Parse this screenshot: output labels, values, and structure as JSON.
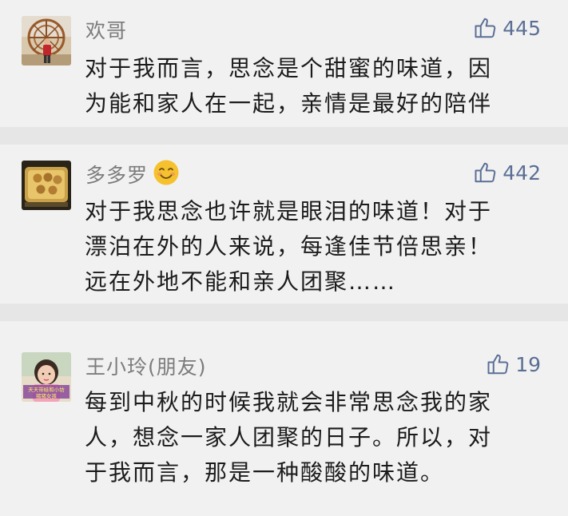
{
  "comments": [
    {
      "nickname": "欢哥",
      "likes": "445",
      "lines": [
        "对于我而言，思念是个甜蜜的味道，因",
        "为能和家人在一起，亲情是最好的陪伴"
      ]
    },
    {
      "nickname": "多多罗",
      "likes": "442",
      "lines": [
        "对于我思念也许就是眼泪的味道！对于",
        "漂泊在外的人来说，每逢佳节倍思亲！",
        "远在外地不能和亲人团聚……"
      ]
    },
    {
      "nickname": "王小玲(朋友)",
      "likes": "19",
      "avatar_caption": "天天带娃和小坊 猪猪女孩",
      "lines": [
        "每到中秋的时候我就会非常思念我的家",
        "人，想念一家人团聚的日子。所以，对",
        "于我而言，那是一种酸酸的味道。"
      ]
    }
  ],
  "colors": {
    "background": "#f1f1f1",
    "separator": "#e6e6e6",
    "like": "#5b6f95",
    "nickname": "#7c7c7c",
    "text": "#1b1b1b"
  },
  "icons": [
    "thumbs-up-icon",
    "smile-emoji-icon"
  ]
}
